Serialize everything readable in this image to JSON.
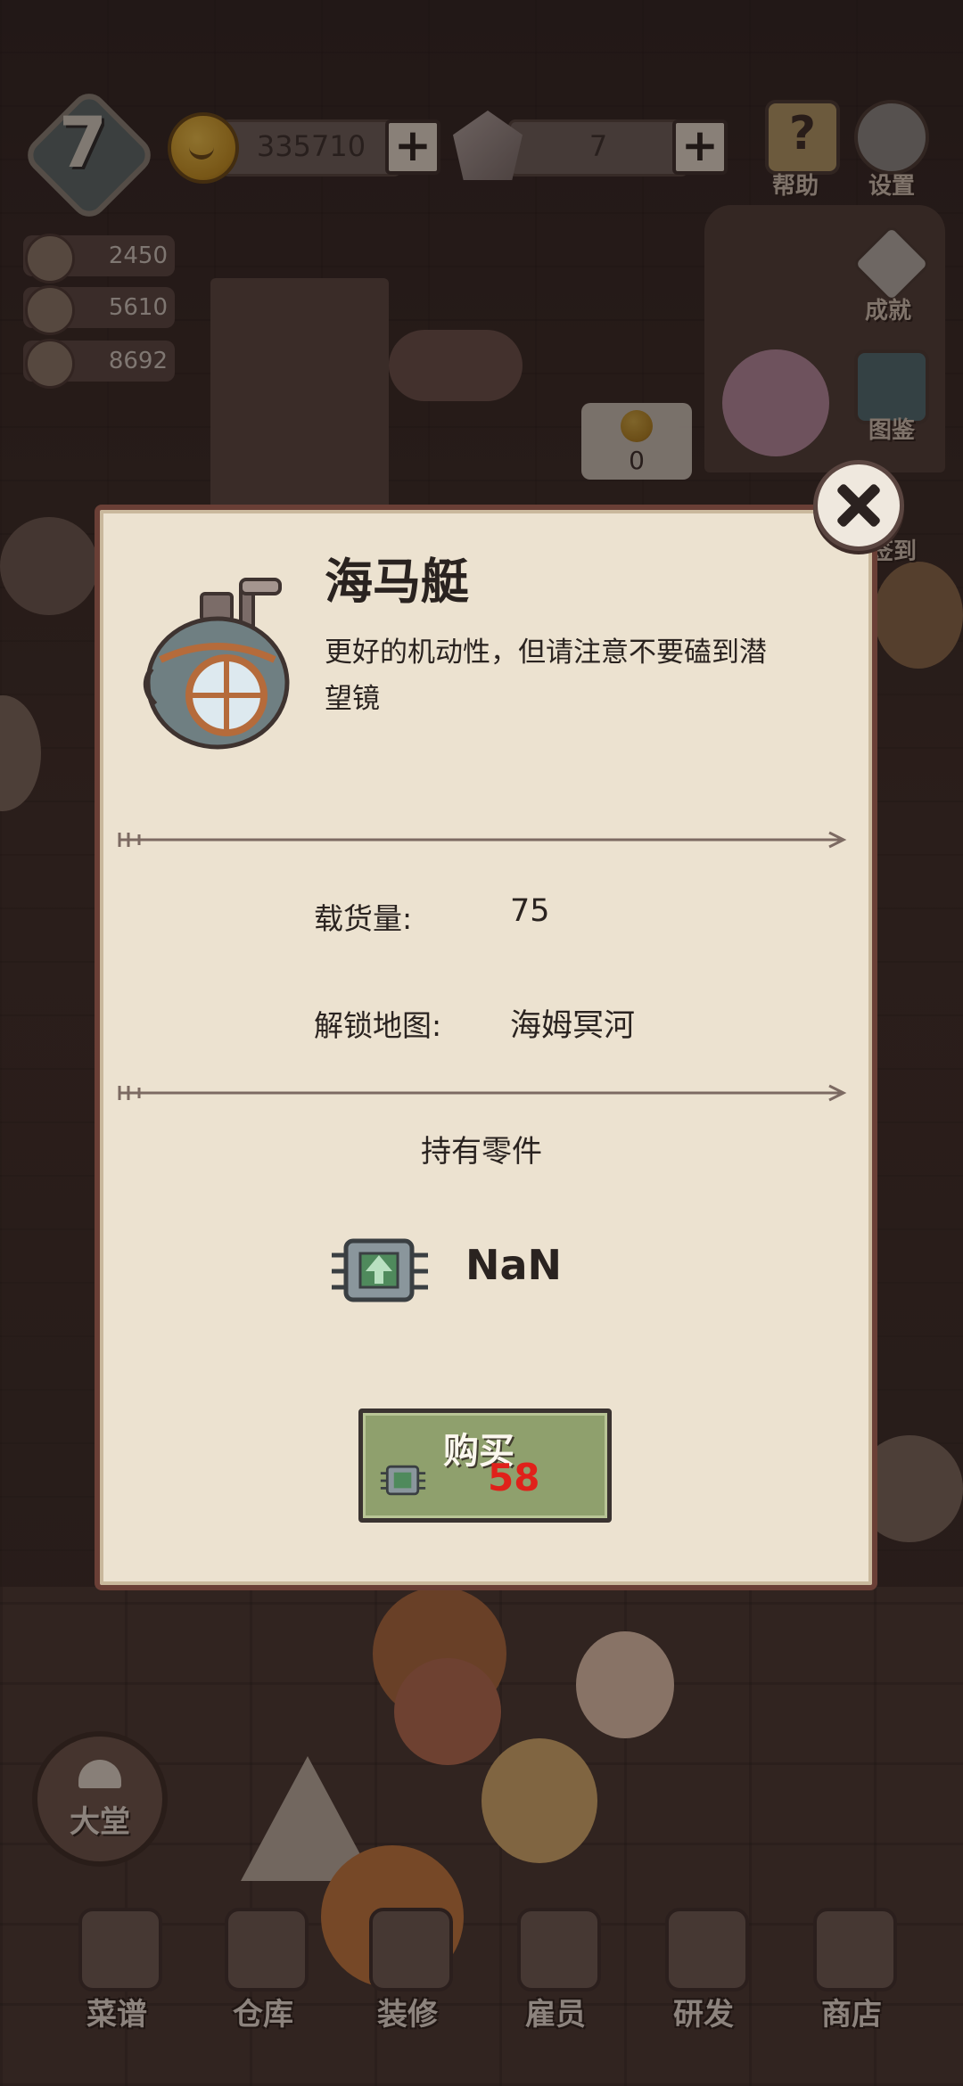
{
  "hud": {
    "level": "7",
    "coins": "335710",
    "gems": "7",
    "help_label": "帮助",
    "settings_label": "设置",
    "achievements_label": "成就",
    "codex_label": "图鉴",
    "signin_label": "签到",
    "resources": [
      {
        "icon": "vegetable-icon",
        "value": "2450"
      },
      {
        "icon": "mushroom-icon",
        "value": "5610"
      },
      {
        "icon": "meat-icon",
        "value": "8692"
      }
    ],
    "coin_bubble_value": "0"
  },
  "dialog": {
    "title": "海马艇",
    "description": "更好的机动性，但请注意不要磕到潜望镜",
    "stats": [
      {
        "label": "载货量:",
        "value": "75"
      },
      {
        "label": "解锁地图:",
        "value": "海姆冥河"
      }
    ],
    "parts_header": "持有零件",
    "parts_count": "NaN",
    "buy_label": "购买",
    "buy_cost": "58"
  },
  "nav": {
    "lobby_label": "大堂",
    "items": [
      {
        "label": "菜谱",
        "icon": "recipe-icon"
      },
      {
        "label": "仓库",
        "icon": "warehouse-icon"
      },
      {
        "label": "装修",
        "icon": "hammer-icon"
      },
      {
        "label": "雇员",
        "icon": "staff-icon"
      },
      {
        "label": "研发",
        "icon": "pot-icon"
      },
      {
        "label": "商店",
        "icon": "shop-icon"
      }
    ]
  },
  "colors": {
    "dialog_bg": "#ece2d0",
    "buy_button": "#8fa06d",
    "cost_red": "#e0211a"
  }
}
